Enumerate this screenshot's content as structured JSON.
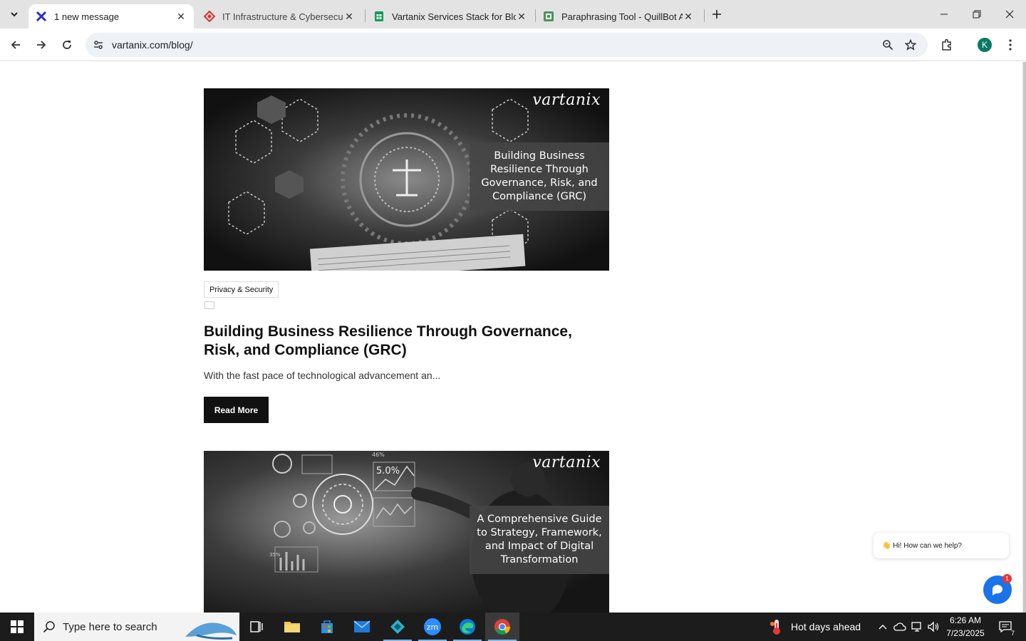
{
  "browser": {
    "tabs": [
      {
        "title": "1 new message",
        "active": true,
        "icon": "x-logo-icon"
      },
      {
        "title": "IT Infrastructure & Cybersecurit",
        "active": false,
        "icon": "red-diamond-icon"
      },
      {
        "title": "Vartanix Services Stack for Blog",
        "active": false,
        "icon": "google-sheets-icon"
      },
      {
        "title": "Paraphrasing Tool - QuillBot AI",
        "active": false,
        "icon": "quillbot-icon"
      }
    ],
    "url": "vartanix.com/blog/",
    "profile_initial": "K"
  },
  "posts": [
    {
      "hero_logo": "vartanix",
      "hero_overlay": "Building Business Resilience Through Governance, Risk, and Compliance (GRC)",
      "category": "Privacy & Security",
      "title": "Building Business Resilience Through Governance, Risk, and Compliance (GRC)",
      "excerpt": "With the fast pace of technological advancement an...",
      "read_more": "Read More"
    },
    {
      "hero_logo": "vartanix",
      "hero_overlay": "A Comprehensive Guide to Strategy, Framework, and Impact of Digital Transformation",
      "hero_stat": "5.0%",
      "hero_stat_small": "46%",
      "hero_stat_small2": "35%"
    }
  ],
  "chat": {
    "greeting": "👋 Hi! How can we help?",
    "badge_count": "1"
  },
  "taskbar": {
    "search_placeholder": "Type here to search",
    "weather": "Hot days ahead",
    "time": "6:26 AM",
    "date": "7/23/2025",
    "notification_count": "7"
  },
  "colors": {
    "accent": "#1a73e8",
    "button": "#111111",
    "tabstrip": "#e3e3e3"
  }
}
